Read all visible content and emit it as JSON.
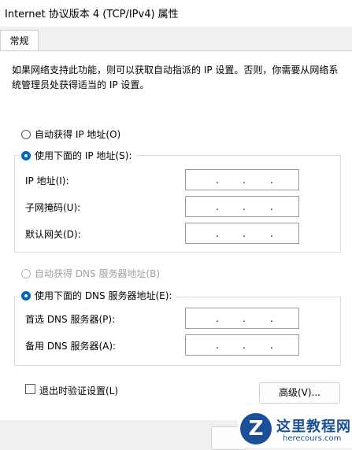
{
  "window": {
    "title": "Internet 协议版本 4 (TCP/IPv4) 属性"
  },
  "tabs": [
    {
      "label": "常规"
    }
  ],
  "description": "如果网络支持此功能，则可以获取自动指派的 IP 设置。否则，你需要从网络系统管理员处获得适当的 IP 设置。",
  "ip": {
    "auto_label": "自动获得 IP 地址(O)",
    "manual_label": "使用下面的 IP 地址(S):",
    "fields": [
      {
        "label": "IP 地址(I):",
        "value": ". . ."
      },
      {
        "label": "子网掩码(U):",
        "value": ". . ."
      },
      {
        "label": "默认网关(D):",
        "value": ". . ."
      }
    ]
  },
  "dns": {
    "auto_label": "自动获得 DNS 服务器地址(B)",
    "manual_label": "使用下面的 DNS 服务器地址(E):",
    "fields": [
      {
        "label": "首选 DNS 服务器(P):",
        "value": ". . ."
      },
      {
        "label": "备用 DNS 服务器(A):",
        "value": ". . ."
      }
    ]
  },
  "validate_label": "退出时验证设置(L)",
  "advanced_button": "高级(V)...",
  "watermark": {
    "site": "这里教程网",
    "url": "herecours.com"
  },
  "colors": {
    "accent": "#0067c0",
    "watermark": "#1a4f9a"
  }
}
